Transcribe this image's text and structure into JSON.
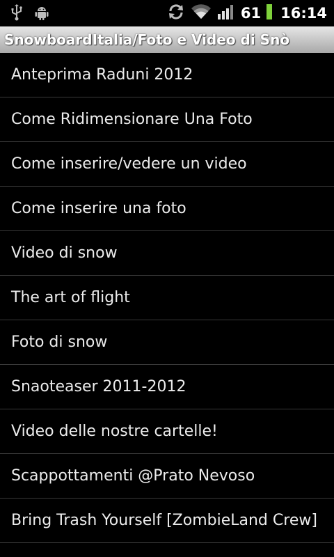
{
  "status_bar": {
    "icons_left": [
      "usb-icon",
      "android-debug-icon"
    ],
    "icons_right": [
      "sync-icon",
      "wifi-icon",
      "signal-icon"
    ],
    "battery_level": "61",
    "battery_color": "#7fd13b",
    "time": "16:14"
  },
  "title_bar": {
    "title": "SnowboardItalia/Foto e Video di Snò"
  },
  "list": {
    "items": [
      {
        "label": "Anteprima Raduni 2012"
      },
      {
        "label": "Come Ridimensionare Una Foto"
      },
      {
        "label": "Come inserire/vedere un video"
      },
      {
        "label": "Come inserire una foto"
      },
      {
        "label": "Video di snow"
      },
      {
        "label": "The art of flight"
      },
      {
        "label": "Foto di snow"
      },
      {
        "label": "Snaoteaser 2011-2012"
      },
      {
        "label": "Video delle nostre cartelle!"
      },
      {
        "label": "Scappottamenti @Prato Nevoso"
      },
      {
        "label": "Bring Trash Yourself [ZombieLand Crew]"
      }
    ]
  }
}
